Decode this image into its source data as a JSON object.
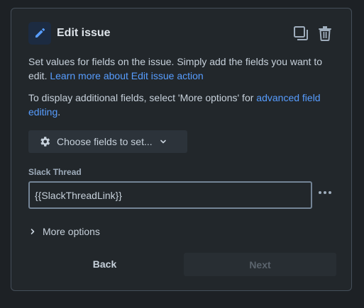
{
  "header": {
    "title": "Edit issue",
    "icon": "pencil-icon",
    "actions": [
      "duplicate-icon",
      "trash-icon"
    ]
  },
  "description": {
    "line1_text": "Set values for fields on the issue. Simply add the fields you want to edit. ",
    "line1_link": "Learn more about Edit issue action",
    "line2_text": "To display additional fields, select 'More options' for ",
    "line2_link": "advanced field editing",
    "line2_end": "."
  },
  "choose_fields": {
    "label": "Choose fields to set...",
    "icon": "gear-icon"
  },
  "field": {
    "label": "Slack Thread",
    "value": "{{SlackThreadLink}}"
  },
  "more_options": {
    "label": "More options"
  },
  "footer": {
    "back_label": "Back",
    "next_label": "Next"
  },
  "colors": {
    "background": "#1d2125",
    "panel": "#22272b",
    "link": "#579dff",
    "icon_accent": "#579dff"
  }
}
